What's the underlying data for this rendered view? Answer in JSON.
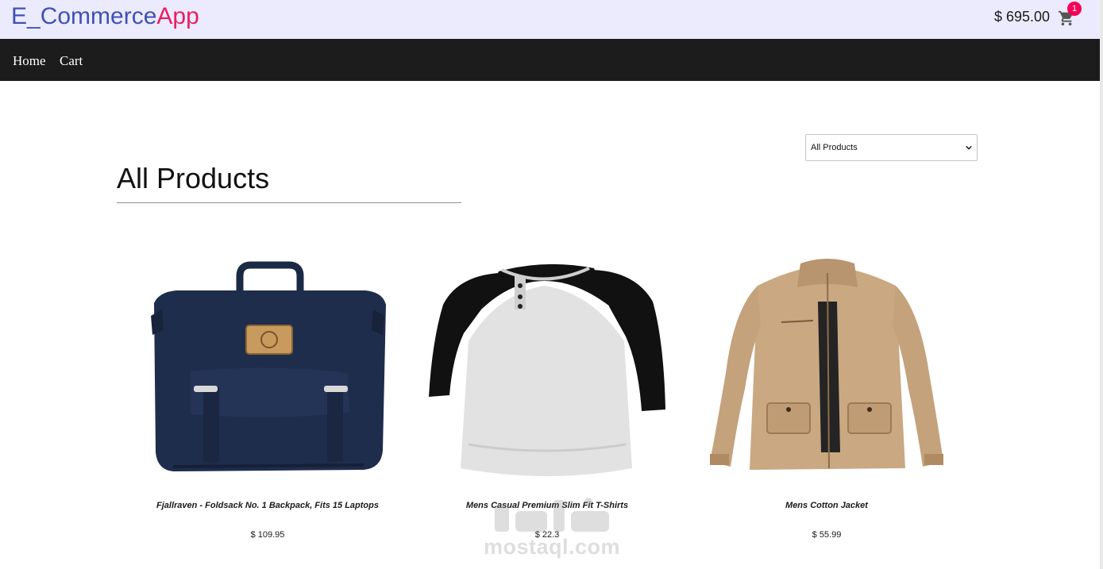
{
  "header": {
    "brand_part1": "E_Commerce",
    "brand_part2": "App",
    "cart_total": "$ 695.00",
    "cart_count": "1",
    "cart_icon": "shopping-cart-icon"
  },
  "nav": {
    "home": "Home",
    "cart": "Cart"
  },
  "main": {
    "title": "All Products",
    "filter_selected": "All Products",
    "filter_icon": "chevron-down-icon"
  },
  "products": [
    {
      "title": "Fjallraven - Foldsack No. 1 Backpack, Fits 15 Laptops",
      "price": "$ 109.95",
      "image": "navy-backpack"
    },
    {
      "title": "Mens Casual Premium Slim Fit T-Shirts",
      "price": "$ 22.3",
      "image": "raglan-henley-tshirt"
    },
    {
      "title": "Mens Cotton Jacket",
      "price": "$ 55.99",
      "image": "khaki-cotton-jacket"
    }
  ],
  "watermark": {
    "text": "mostaql.com"
  },
  "colors": {
    "brand_blue": "#3f51b5",
    "brand_pink": "#e91e63",
    "badge": "#f50057",
    "topbar_bg": "#ebebfd",
    "navbar_bg": "#1c1c1c"
  }
}
